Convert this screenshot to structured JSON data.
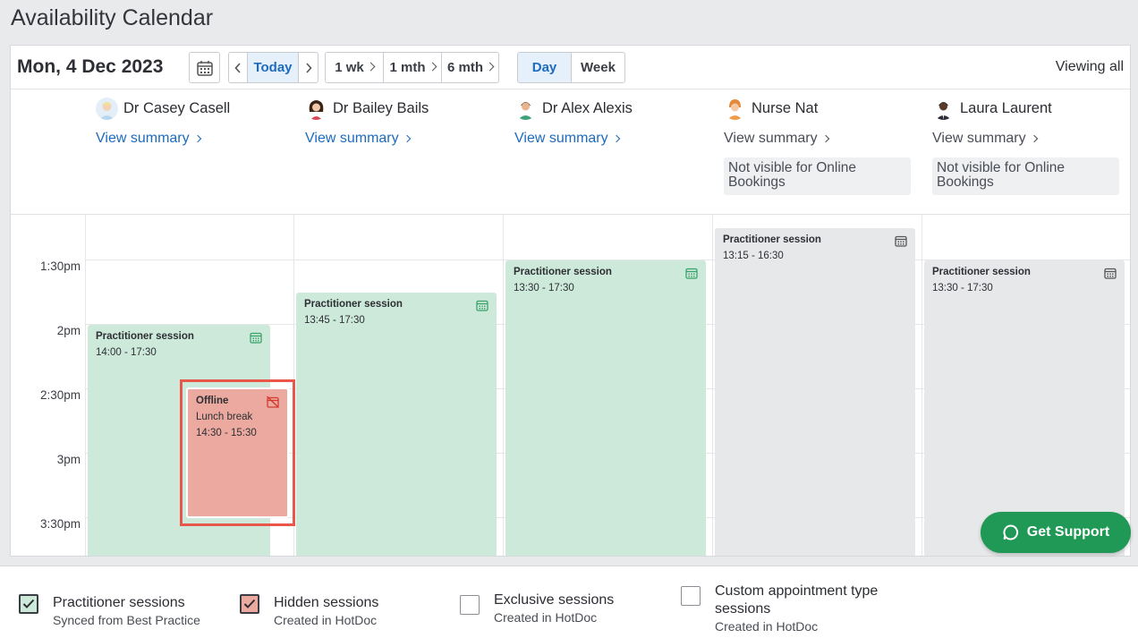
{
  "page_title": "Availability Calendar",
  "toolbar": {
    "date": "Mon, 4 Dec 2023",
    "today_label": "Today",
    "range_options": [
      "1 wk",
      "1 mth",
      "6 mth"
    ],
    "view_options": [
      "Day",
      "Week"
    ],
    "active_view": "Day",
    "viewing_label": "Viewing all"
  },
  "practitioners": [
    {
      "name": "Dr Casey Casell",
      "summary": "View summary",
      "note": ""
    },
    {
      "name": "Dr Bailey Bails",
      "summary": "View summary",
      "note": ""
    },
    {
      "name": "Dr Alex Alexis",
      "summary": "View summary",
      "note": ""
    },
    {
      "name": "Nurse Nat",
      "summary": "View summary",
      "note": "Not visible for Online Bookings"
    },
    {
      "name": "Laura Laurent",
      "summary": "View summary",
      "note": "Not visible for Online Bookings"
    }
  ],
  "time_labels": [
    "1:30pm",
    "2pm",
    "2:30pm",
    "3pm",
    "3:30pm"
  ],
  "events": {
    "casey_session": {
      "title": "Practitioner session",
      "time": "14:00 - 17:30"
    },
    "casey_offline": {
      "title": "Offline",
      "subtitle": "Lunch break",
      "time": "14:30 - 15:30"
    },
    "bailey_session": {
      "title": "Practitioner session",
      "time": "13:45 - 17:30"
    },
    "alex_session": {
      "title": "Practitioner session",
      "time": "13:30 - 17:30"
    },
    "nat_session": {
      "title": "Practitioner session",
      "time": "13:15 - 16:30"
    },
    "laura_session": {
      "title": "Practitioner session",
      "time": "13:30 - 17:30"
    }
  },
  "support_button": "Get Support",
  "legend": [
    {
      "title": "Practitioner sessions",
      "subtitle": "Synced from Best Practice",
      "checked": true
    },
    {
      "title": "Hidden sessions",
      "subtitle": "Created in HotDoc",
      "checked": true
    },
    {
      "title": "Exclusive sessions",
      "subtitle": "Created in HotDoc",
      "checked": false
    },
    {
      "title": "Custom appointment type sessions",
      "subtitle": "Created in HotDoc",
      "checked": false
    }
  ],
  "colors": {
    "accent_blue": "#1d6bbf",
    "session_green": "#cde9da",
    "session_gray": "#e7e8ea",
    "offline_red": "#eca99f",
    "highlight": "#e8574a",
    "support_green": "#1f9955"
  }
}
